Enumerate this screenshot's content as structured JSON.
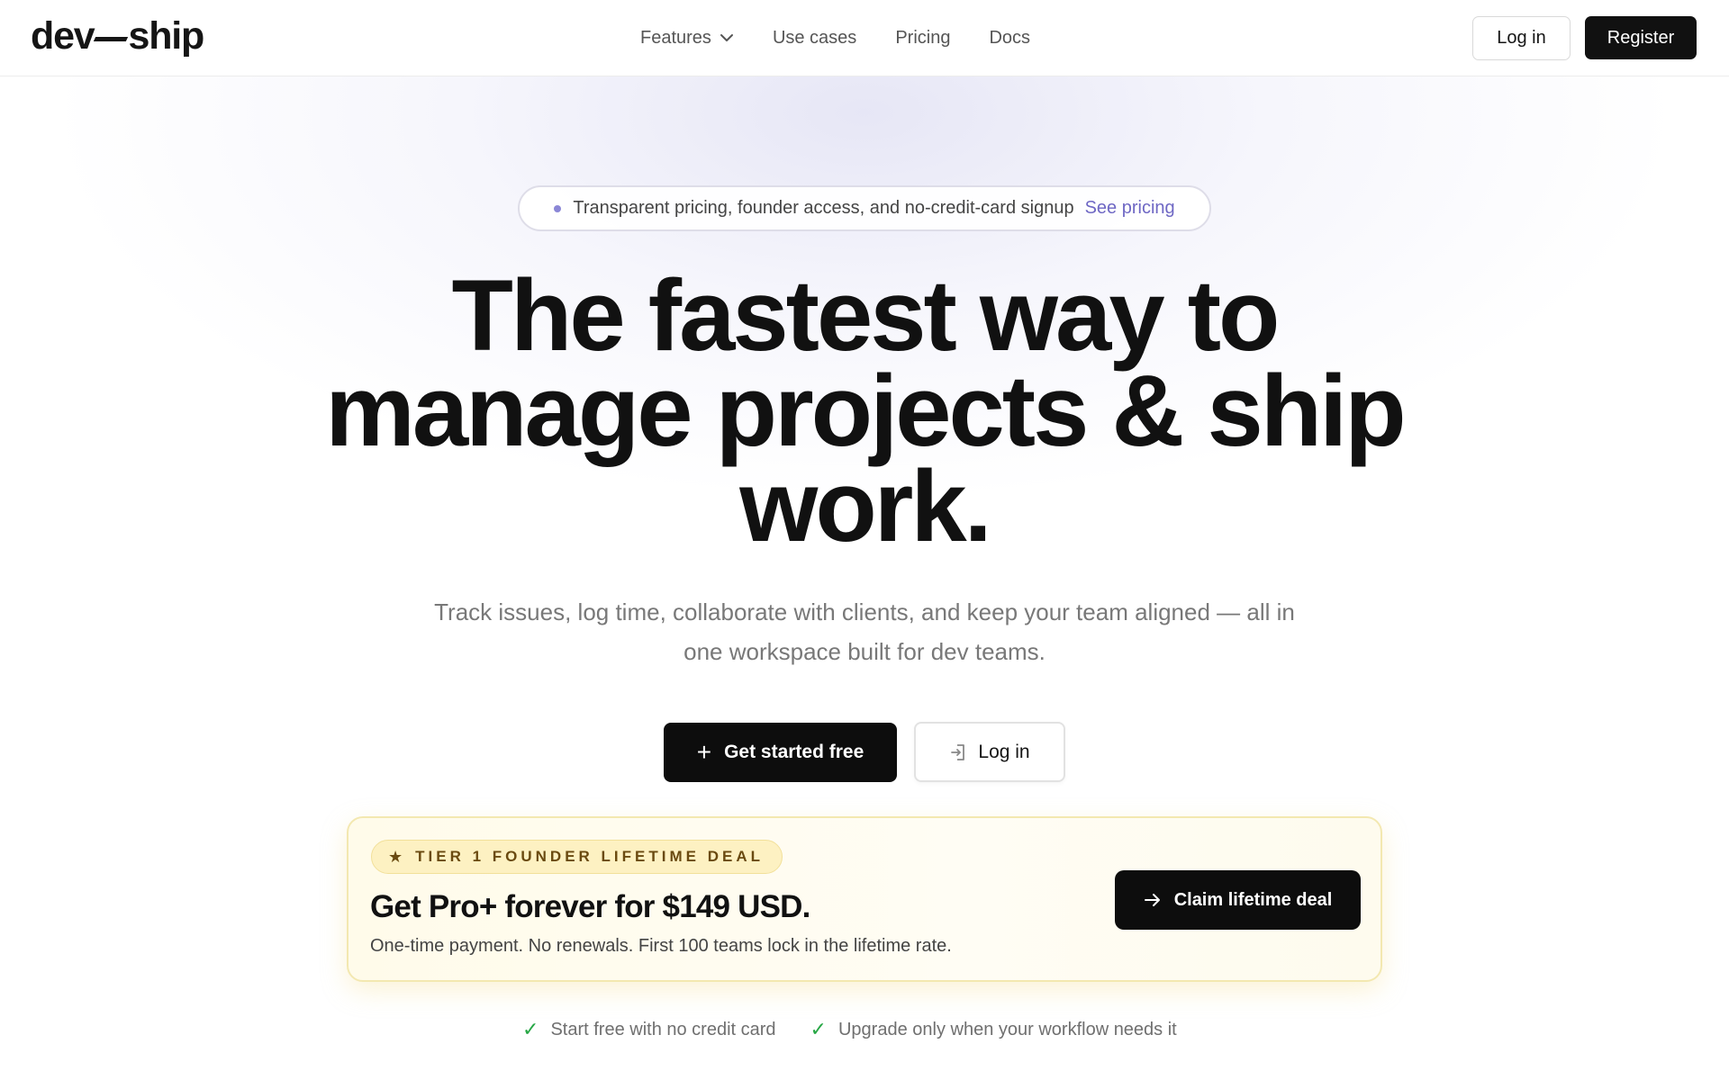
{
  "nav": {
    "logo_left": "dev",
    "logo_right": "ship",
    "links": [
      {
        "label": "Features",
        "has_dropdown": true
      },
      {
        "label": "Use cases"
      },
      {
        "label": "Pricing"
      },
      {
        "label": "Docs"
      }
    ],
    "login_label": "Log in",
    "register_label": "Register"
  },
  "announcement": {
    "text": "Transparent pricing, founder access, and no-credit-card signup",
    "link_label": "See pricing"
  },
  "hero": {
    "title_line1": "The fastest way to",
    "title_line2": "manage projects & ship",
    "title_line3": "work.",
    "subtitle_line1": "Track issues, log time, collaborate with clients, and keep your team aligned — all in",
    "subtitle_line2": "one workspace built for dev teams.",
    "primary_label": "Get started free",
    "secondary_label": "Log in"
  },
  "deal": {
    "badge": "TIER 1 FOUNDER LIFETIME DEAL",
    "title": "Get Pro+ forever for $149 USD.",
    "description": "One-time payment. No renewals. First 100 teams lock in the lifetime rate.",
    "button_label": "Claim lifetime deal"
  },
  "checks": [
    "Start free with no credit card",
    "Upgrade only when your workflow needs it"
  ],
  "colors": {
    "primary": "#111111",
    "accent_link": "#6e67c4",
    "deal_background": "#fffbea",
    "check": "#27a745"
  },
  "icons": [
    "chevron-down-icon",
    "plus-icon",
    "login-icon",
    "star-icon",
    "arrow-right-icon",
    "check-icon"
  ]
}
